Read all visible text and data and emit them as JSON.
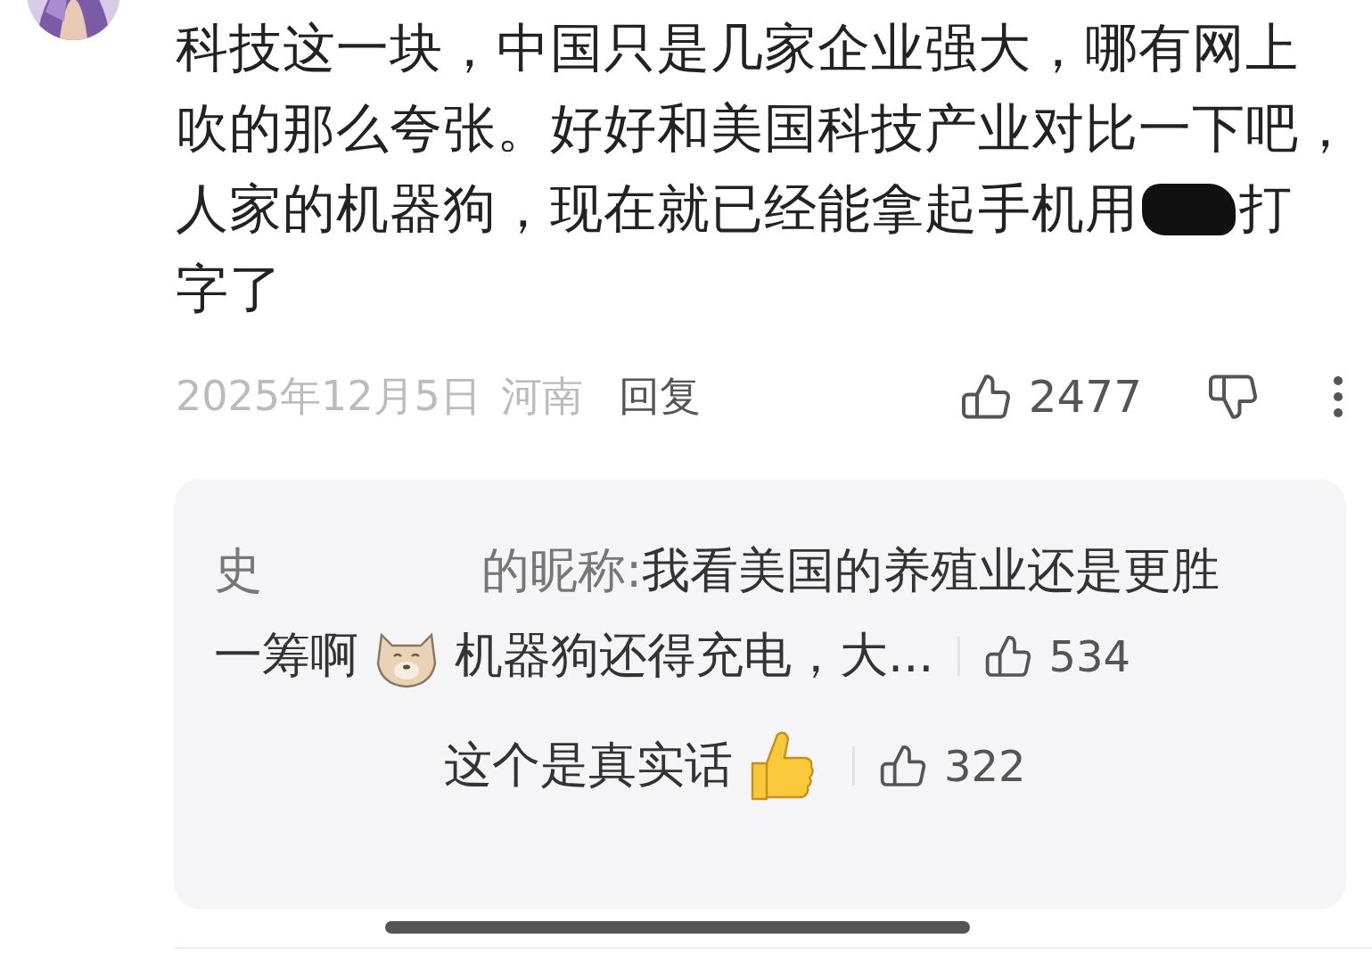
{
  "comment": {
    "lines": [
      {
        "parts": [
          {
            "kind": "text",
            "text": "科技这一块，中国只是几家企业强大，哪有网上"
          }
        ]
      },
      {
        "parts": [
          {
            "kind": "text",
            "text": "吹的那么夸张。好好和美国科技产业对比一下吧，"
          }
        ]
      },
      {
        "parts": [
          {
            "kind": "text",
            "text": "人家的机器狗，现在就已经能拿起手机用"
          },
          {
            "kind": "redaction"
          },
          {
            "kind": "text",
            "text": "打"
          }
        ]
      },
      {
        "parts": [
          {
            "kind": "text",
            "text": "字了"
          }
        ]
      }
    ],
    "date": "2025年12月5日",
    "location": "河南",
    "reply_button": "回复",
    "like_count": "2477"
  },
  "replies": [
    {
      "lines": [
        {
          "parts": [
            {
              "kind": "author",
              "text": "史"
            },
            {
              "kind": "blurred-name"
            },
            {
              "kind": "author",
              "text": "的昵称:"
            },
            {
              "kind": "text",
              "text": "我看美国的养殖业还是更胜"
            }
          ]
        },
        {
          "parts": [
            {
              "kind": "text",
              "text": "一筹啊"
            },
            {
              "kind": "dog-emoji"
            },
            {
              "kind": "text",
              "text": "机器狗还得充电，大..."
            }
          ]
        }
      ],
      "like_count": "534"
    },
    {
      "lines": [
        {
          "parts": [
            {
              "kind": "blurred-name"
            },
            {
              "kind": "text",
              "text": "这个是真实话"
            },
            {
              "kind": "thumbs-up-emoji"
            }
          ]
        }
      ],
      "like_count": "322"
    }
  ]
}
